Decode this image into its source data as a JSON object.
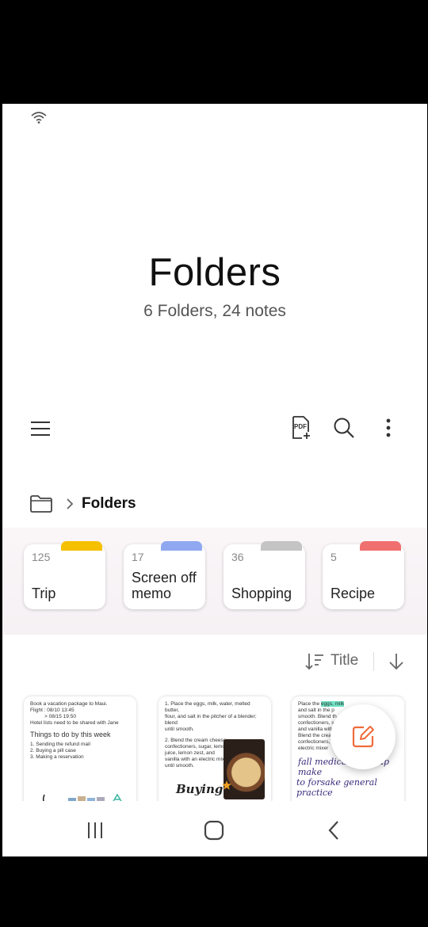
{
  "header": {
    "title": "Folders",
    "subtitle": "6 Folders, 24 notes"
  },
  "toolbar": {
    "icons": [
      "menu-icon",
      "pdf-add-icon",
      "search-icon",
      "more-vertical-icon"
    ]
  },
  "breadcrumb": {
    "label": "Folders"
  },
  "folders": [
    {
      "count": "125",
      "name": "Trip",
      "color": "#f5c000"
    },
    {
      "count": "17",
      "name": "Screen off memo",
      "color": "#8fa8f0"
    },
    {
      "count": "36",
      "name": "Shopping",
      "color": "#c4c4c4"
    },
    {
      "count": "5",
      "name": "Recipe",
      "color": "#f07070"
    }
  ],
  "sort": {
    "label": "Title"
  },
  "notes": [
    {
      "line1": "Book a vacation package to Maui.",
      "line2": "Flight  : 08/10 13:45",
      "line3": "> 08/15 19:50",
      "line4": "Hotel lists need to be shared with Jane",
      "heading": "Things to do by this week",
      "item1": "1. Sending the refund mail",
      "item2": "2. Buying a pill case",
      "item3": "3. Making a reservation"
    },
    {
      "line1": "1. Place the eggs, milk, water, melted butter,",
      "line2": "flour, and salt in the pitcher of a blender; blend",
      "line3": "until smooth.",
      "line4": "2. Blend the cream cheese,",
      "line5": "confectioners, sugar, lemon",
      "line6": "juice, lemon zest, and",
      "line7": "vanilla with an electric mixer",
      "line8": "until smooth.",
      "handwriting": "Buying"
    },
    {
      "line1a": "Place the ",
      "line1b": "eggs, milk",
      "line2": "and salt in the p",
      "line3": "smooth. Blend th",
      "line4": "confectioners, s",
      "line5": "and vanilla with",
      "line6": "Blend the cream",
      "line7": "confectioners, s",
      "line8": "electric mixer",
      "hand1": "fall medical checkup make",
      "hand2": "to forsake general practice"
    }
  ],
  "colors": {
    "accent": "#f06b3a",
    "background": "#ffffff"
  }
}
